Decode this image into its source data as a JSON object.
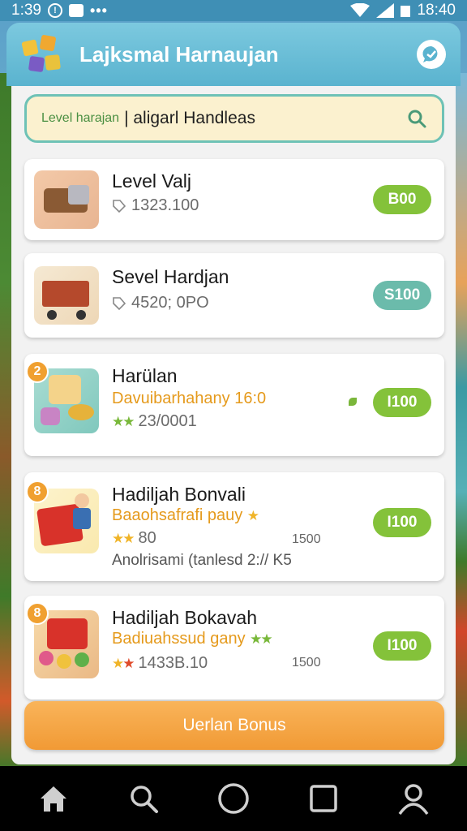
{
  "status_bar": {
    "time_left": "1:39",
    "time_right": "18:40"
  },
  "header": {
    "title": "Lajksmal Harnaujan"
  },
  "search": {
    "highlight": "Level harajan",
    "placeholder": "| aligarl Handleas"
  },
  "items": [
    {
      "title": "Level Valj",
      "sub": "1323.100",
      "price": "B00",
      "price_color": "#84c23a"
    },
    {
      "title": "Sevel Hardjan",
      "sub": "4520; 0PO",
      "price": "S100",
      "price_color": "#6bbbab"
    },
    {
      "badge": "2",
      "title": "Harülan",
      "promo": "Davuibarhahany 16:0",
      "sub": "23/0001",
      "price": "I100",
      "price_color": "#84c23a"
    },
    {
      "badge": "8",
      "title": "Hadiljah Bonvali",
      "promo": "Baaohsafrafi pauy",
      "sub": "80",
      "amount": "1500",
      "note": "Anolrisami (tanlesd 2:// K5",
      "price": "I100",
      "price_color": "#84c23a"
    },
    {
      "badge": "8",
      "title": "Hadiljah Bokavah",
      "promo": "Badiuahssud gany",
      "sub": "1433B.10",
      "amount": "1500",
      "price": "I100",
      "price_color": "#84c23a"
    }
  ],
  "bonus_button": "Uerlan Bonus",
  "nav": [
    "home-icon",
    "search-icon",
    "circle-home-icon",
    "square-recents-icon",
    "profile-icon"
  ]
}
